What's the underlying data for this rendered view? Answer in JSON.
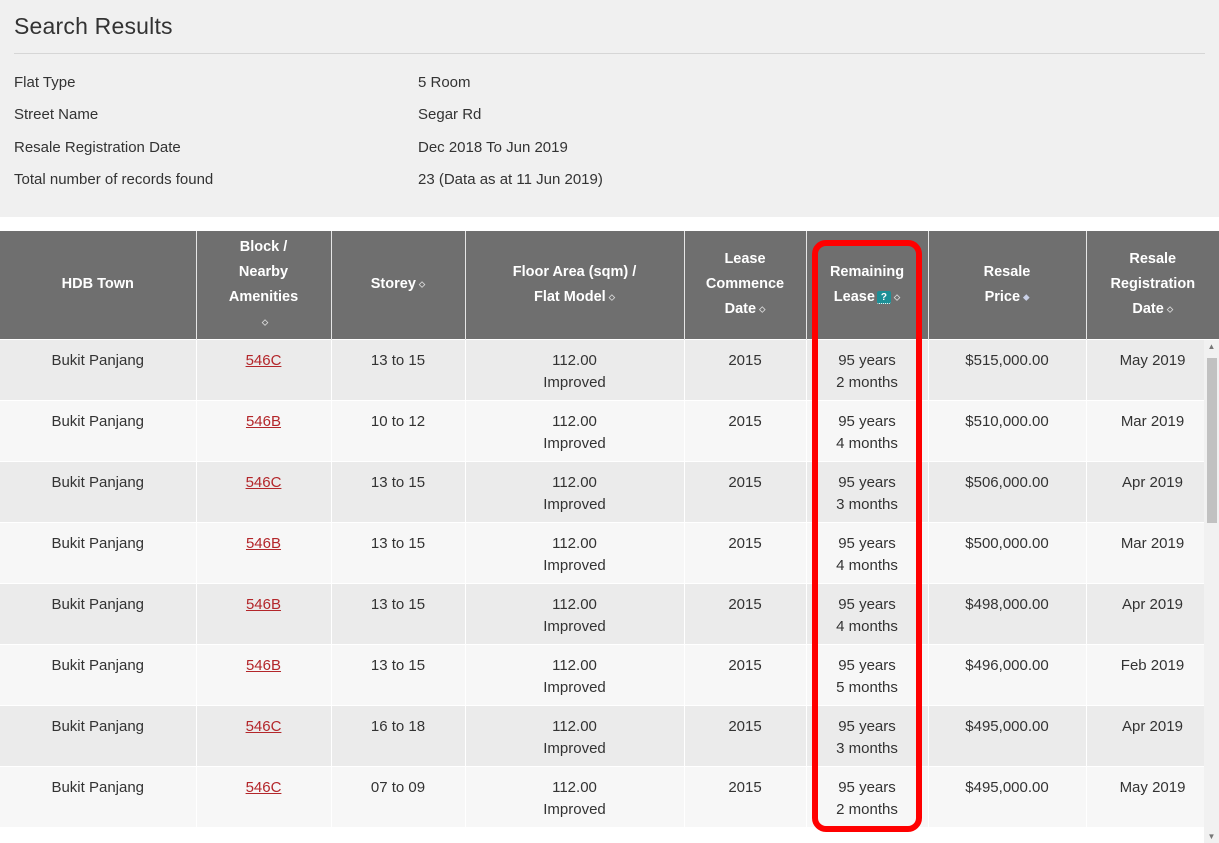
{
  "summary": {
    "title": "Search Results",
    "rows": [
      {
        "label": "Flat Type",
        "value": "5 Room"
      },
      {
        "label": "Street Name",
        "value": "Segar Rd"
      },
      {
        "label": "Resale Registration Date",
        "value": "Dec 2018 To Jun 2019"
      },
      {
        "label": "Total number of records found",
        "value": "23 (Data as at 11 Jun 2019)"
      }
    ]
  },
  "table": {
    "headers": {
      "town_l1": "HDB Town",
      "block_l1": "Block /",
      "block_l2": "Nearby",
      "block_l3": "Amenities",
      "storey_l1": "Storey",
      "area_l1": "Floor Area (sqm) /",
      "area_l2": "Flat Model",
      "lease_l1": "Lease",
      "lease_l2": "Commence",
      "lease_l3": "Date",
      "remaining_l1": "Remaining",
      "remaining_l2": "Lease",
      "help": "?",
      "price_l1": "Resale",
      "price_l2": "Price",
      "reg_l1": "Resale",
      "reg_l2": "Registration",
      "reg_l3": "Date"
    },
    "sort_glyph": "⬦",
    "sort_active_glyph": "⬥",
    "rows": [
      {
        "town": "Bukit Panjang",
        "block": "546C",
        "storey": "13 to 15",
        "area": "112.00",
        "model": "Improved",
        "lease": "2015",
        "rem_y": "95 years",
        "rem_m": "2 months",
        "price": "$515,000.00",
        "reg": "May 2019"
      },
      {
        "town": "Bukit Panjang",
        "block": "546B",
        "storey": "10 to 12",
        "area": "112.00",
        "model": "Improved",
        "lease": "2015",
        "rem_y": "95 years",
        "rem_m": "4 months",
        "price": "$510,000.00",
        "reg": "Mar 2019"
      },
      {
        "town": "Bukit Panjang",
        "block": "546C",
        "storey": "13 to 15",
        "area": "112.00",
        "model": "Improved",
        "lease": "2015",
        "rem_y": "95 years",
        "rem_m": "3 months",
        "price": "$506,000.00",
        "reg": "Apr 2019"
      },
      {
        "town": "Bukit Panjang",
        "block": "546B",
        "storey": "13 to 15",
        "area": "112.00",
        "model": "Improved",
        "lease": "2015",
        "rem_y": "95 years",
        "rem_m": "4 months",
        "price": "$500,000.00",
        "reg": "Mar 2019"
      },
      {
        "town": "Bukit Panjang",
        "block": "546B",
        "storey": "13 to 15",
        "area": "112.00",
        "model": "Improved",
        "lease": "2015",
        "rem_y": "95 years",
        "rem_m": "4 months",
        "price": "$498,000.00",
        "reg": "Apr 2019"
      },
      {
        "town": "Bukit Panjang",
        "block": "546B",
        "storey": "13 to 15",
        "area": "112.00",
        "model": "Improved",
        "lease": "2015",
        "rem_y": "95 years",
        "rem_m": "5 months",
        "price": "$496,000.00",
        "reg": "Feb 2019"
      },
      {
        "town": "Bukit Panjang",
        "block": "546C",
        "storey": "16 to 18",
        "area": "112.00",
        "model": "Improved",
        "lease": "2015",
        "rem_y": "95 years",
        "rem_m": "3 months",
        "price": "$495,000.00",
        "reg": "Apr 2019"
      },
      {
        "town": "Bukit Panjang",
        "block": "546C",
        "storey": "07 to 09",
        "area": "112.00",
        "model": "Improved",
        "lease": "2015",
        "rem_y": "95 years",
        "rem_m": "2 months",
        "price": "$495,000.00",
        "reg": "May 2019"
      }
    ]
  },
  "colors": {
    "header_bg": "#6f6f6f",
    "link": "#b3262a",
    "annotation": "#ff0000",
    "help_badge": "#1d8f96"
  }
}
